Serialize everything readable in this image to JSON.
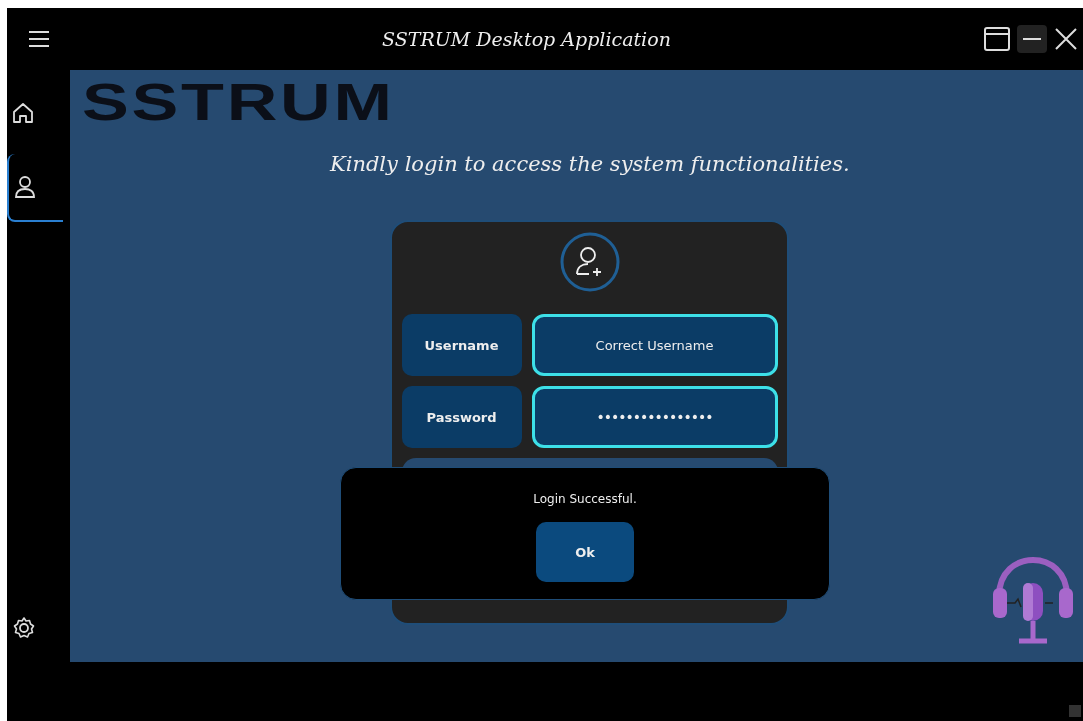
{
  "window": {
    "title": "SSTRUM Desktop Application"
  },
  "sidebar": {
    "items": [
      {
        "selected": false
      },
      {
        "selected": true
      }
    ]
  },
  "logo": "SSTRUM",
  "tagline": "Kindly login to access the system functionalities.",
  "login": {
    "username": {
      "label": "Username",
      "value": "Correct Username"
    },
    "password": {
      "label": "Password",
      "value": "••••••••••••••••"
    }
  },
  "dialog": {
    "message": "Login Successful.",
    "button": "Ok"
  }
}
